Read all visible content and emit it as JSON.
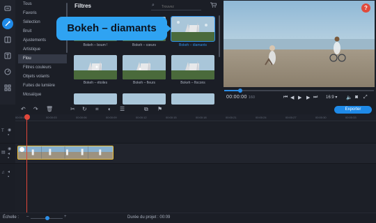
{
  "sidebar": {
    "categories": [
      {
        "label": "Tous"
      },
      {
        "label": "Favoris"
      },
      {
        "label": "Sélection"
      },
      {
        "label": "Bruit"
      },
      {
        "label": "Ajustements"
      },
      {
        "label": "Artistique"
      },
      {
        "label": "Flou"
      },
      {
        "label": "Filtres couleurs"
      },
      {
        "label": "Objets volants"
      },
      {
        "label": "Fuites de lumière"
      },
      {
        "label": "Mosaïque"
      }
    ],
    "selected": "Flou"
  },
  "filters": {
    "title": "Filtres",
    "search_placeholder": "Trouvez",
    "items": [
      {
        "label": "Bokeh – boum !"
      },
      {
        "label": "Bokeh – cœurs"
      },
      {
        "label": "Bokeh – diamants"
      },
      {
        "label": "Bokeh – étoiles"
      },
      {
        "label": "Bokeh – fleurs"
      },
      {
        "label": "Bokeh – flocons"
      }
    ],
    "selected": "Bokeh – diamants"
  },
  "tooltip": {
    "text": "Bokeh – diamants"
  },
  "preview": {
    "help_label": "?",
    "progress": 0.1,
    "timecode_main": "00:00:00",
    "timecode_ms": "160",
    "aspect_ratio": "16:9 ▾"
  },
  "toolbar": {
    "export_label": "Exporter"
  },
  "ruler": {
    "ticks": [
      "00:00:00",
      "00:00:03",
      "00:00:06",
      "00:00:09",
      "00:00:12",
      "00:00:15",
      "00:00:18",
      "00:00:21",
      "00:00:24",
      "00:00:27",
      "00:00:30",
      "00:00:33"
    ]
  },
  "bottom": {
    "scale_label": "Échelle :",
    "duration_label": "Durée du projet : 00:09",
    "zoom_level": 0.55
  },
  "colors": {
    "accent": "#1f8ae8",
    "tooltip": "#2fa3f2",
    "playhead": "#e0473b",
    "clip_border": "#f0c23b",
    "background": "#1b1e26"
  }
}
